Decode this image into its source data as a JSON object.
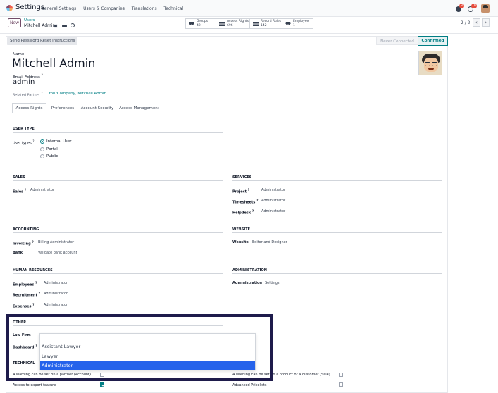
{
  "navbar": {
    "app_title": "Settings",
    "menu": [
      "General Settings",
      "Users & Companies",
      "Translations",
      "Technical"
    ],
    "chat_badge": "8",
    "activity_badge": "10"
  },
  "control": {
    "new_label": "New",
    "breadcrumb_parent": "Users",
    "breadcrumb_current": "Mitchell Admin",
    "stats": [
      {
        "label": "Groups",
        "value": "42"
      },
      {
        "label": "Access Rights",
        "value": "696"
      },
      {
        "label": "Record Rules",
        "value": "142"
      },
      {
        "label": "Employee",
        "value": "1"
      }
    ],
    "pager": "2 / 2",
    "prev": "‹",
    "next": "›"
  },
  "statusbar": {
    "reset_label": "Send Password Reset Instructions",
    "status_never": "Never Connected",
    "status_confirmed": "Confirmed"
  },
  "form": {
    "name_label": "Name",
    "name": "Mitchell Admin",
    "email_label": "Email Address",
    "email": "admin",
    "partner_label": "Related Partner",
    "partner": "YourCompany, Mitchell Admin",
    "help_mark": "?"
  },
  "tabs": [
    "Access Rights",
    "Preferences",
    "Account Security",
    "Access Management"
  ],
  "user_type": {
    "title": "USER TYPE",
    "label": "User types",
    "options": [
      "Internal User",
      "Portal",
      "Public"
    ],
    "selected": "Internal User"
  },
  "sections": {
    "sales": {
      "title": "SALES",
      "fields": [
        {
          "label": "Sales",
          "value": "Administrator"
        }
      ]
    },
    "services": {
      "title": "SERVICES",
      "fields": [
        {
          "label": "Project",
          "value": "Administrator"
        },
        {
          "label": "Timesheets",
          "value": "Administrator"
        },
        {
          "label": "Helpdesk",
          "value": "Administrator"
        }
      ]
    },
    "accounting": {
      "title": "ACCOUNTING",
      "fields": [
        {
          "label": "Invoicing",
          "value": "Billing Administrator"
        },
        {
          "label": "Bank",
          "value": "Validate bank account"
        }
      ]
    },
    "website": {
      "title": "WEBSITE",
      "fields": [
        {
          "label": "Website",
          "value": "Editor and Designer"
        }
      ]
    },
    "hr": {
      "title": "HUMAN RESOURCES",
      "fields": [
        {
          "label": "Employees",
          "value": "Administrator"
        },
        {
          "label": "Recruitment",
          "value": "Administrator"
        },
        {
          "label": "Expenses",
          "value": "Administrator"
        }
      ]
    },
    "administration": {
      "title": "ADMINISTRATION",
      "fields": [
        {
          "label": "Administration",
          "value": "Settings"
        }
      ]
    },
    "other": {
      "title": "OTHER",
      "fields": [
        {
          "label": "Law Firm",
          "value": ""
        },
        {
          "label": "Dashboard",
          "value": ""
        }
      ]
    },
    "technical": {
      "title": "TECHNICAL"
    }
  },
  "dropdown": {
    "options": [
      "Assistant Lawyer",
      "Lawyer",
      "Administrator"
    ],
    "selected": "Administrator"
  },
  "technical_rows": [
    {
      "label": "A warning can be set on a partner (Account)",
      "checked": false
    },
    {
      "label": "A warning can be set on a product or a customer (Sale)",
      "checked": false
    },
    {
      "label": "Access to export feature",
      "checked": true
    },
    {
      "label": "Advanced Pricelists",
      "checked": false
    }
  ]
}
